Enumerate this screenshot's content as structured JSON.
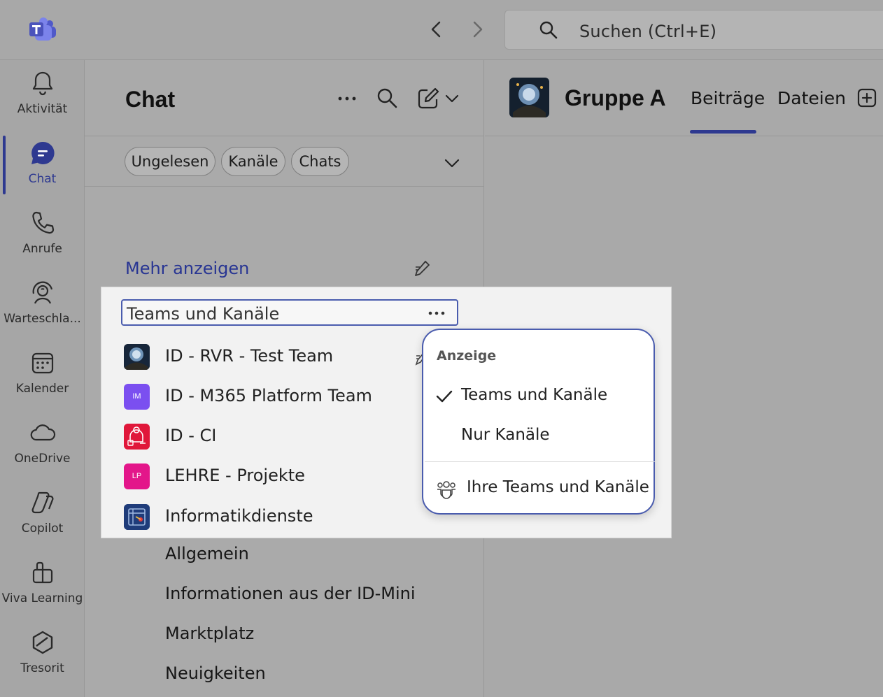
{
  "search": {
    "label": "Suchen (Ctrl+E)"
  },
  "rail": {
    "items": [
      {
        "label": "Aktivität",
        "icon": "bell-icon"
      },
      {
        "label": "Chat",
        "icon": "chat-icon",
        "active": true
      },
      {
        "label": "Anrufe",
        "icon": "phone-icon"
      },
      {
        "label": "Warteschla...",
        "icon": "queue-icon"
      },
      {
        "label": "Kalender",
        "icon": "calendar-icon"
      },
      {
        "label": "OneDrive",
        "icon": "cloud-icon"
      },
      {
        "label": "Copilot",
        "icon": "copilot-icon"
      },
      {
        "label": "Viva Learning",
        "icon": "book-icon"
      },
      {
        "label": "Tresorit",
        "icon": "tresorit-icon"
      }
    ]
  },
  "chat": {
    "title": "Chat",
    "filters": [
      "Ungelesen",
      "Kanäle",
      "Chats"
    ],
    "show_more": "Mehr anzeigen",
    "section_header": "Teams und Kanäle",
    "teams": [
      {
        "name": "ID - RVR - Test Team",
        "avatar_text": ""
      },
      {
        "name": "ID - M365 Platform Team",
        "avatar_text": "IM"
      },
      {
        "name": "ID - CI",
        "avatar_text": ""
      },
      {
        "name": "LEHRE - Projekte",
        "avatar_text": "LP"
      },
      {
        "name": "Informatikdienste",
        "avatar_text": ""
      }
    ],
    "channels": [
      "Allgemein",
      "Informationen aus der ID-Mini",
      "Marktplatz",
      "Neuigkeiten"
    ]
  },
  "conversation": {
    "group_name": "Gruppe A",
    "tabs": [
      "Beiträge",
      "Dateien"
    ],
    "active_tab": "Beiträge"
  },
  "view_menu": {
    "heading": "Anzeige",
    "options": [
      {
        "label": "Teams und Kanäle",
        "checked": true
      },
      {
        "label": "Nur Kanäle",
        "checked": false
      }
    ],
    "footer_item": "Ihre Teams und Kanäle"
  },
  "colors": {
    "accent": "#2e3990",
    "menu_border": "#4a5cae",
    "avatar_im": "#7b4ff0",
    "avatar_ci": "#e0173a",
    "avatar_lp": "#e3168a",
    "avatar_info": "#1f3c7a"
  }
}
